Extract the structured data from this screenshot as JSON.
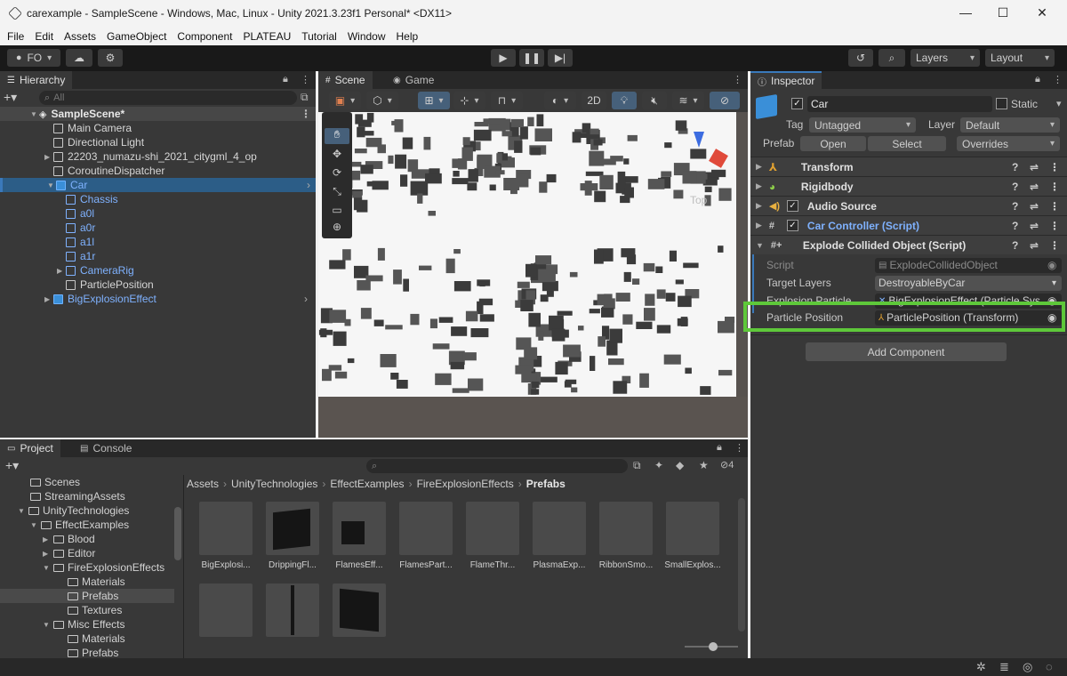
{
  "window": {
    "title": "carexample - SampleScene - Windows, Mac, Linux - Unity 2021.3.23f1 Personal* <DX11>",
    "minimize": "—",
    "maximize": "☐",
    "close": "✕"
  },
  "menu": [
    "File",
    "Edit",
    "Assets",
    "GameObject",
    "Component",
    "PLATEAU",
    "Tutorial",
    "Window",
    "Help"
  ],
  "toolbar": {
    "account": "FO",
    "layers": "Layers",
    "layout": "Layout"
  },
  "hierarchy": {
    "tab": "Hierarchy",
    "search_placeholder": "All",
    "scene": "SampleScene*",
    "items": [
      {
        "label": "Main Camera"
      },
      {
        "label": "Directional Light"
      },
      {
        "label": "22203_numazu-shi_2021_citygml_4_op"
      },
      {
        "label": "CoroutineDispatcher"
      },
      {
        "label": "Car"
      },
      {
        "label": "Chassis"
      },
      {
        "label": "a0l"
      },
      {
        "label": "a0r"
      },
      {
        "label": "a1l"
      },
      {
        "label": "a1r"
      },
      {
        "label": "CameraRig"
      },
      {
        "label": "ParticlePosition"
      },
      {
        "label": "BigExplosionEffect"
      }
    ]
  },
  "scene": {
    "tab_scene": "Scene",
    "tab_game": "Game",
    "btn_2d": "2D",
    "gizmo_label": "Top"
  },
  "inspector": {
    "tab": "Inspector",
    "object_name": "Car",
    "static_label": "Static",
    "tag_label": "Tag",
    "tag_value": "Untagged",
    "layer_label": "Layer",
    "layer_value": "Default",
    "prefab_label": "Prefab",
    "prefab_open": "Open",
    "prefab_select": "Select",
    "prefab_overrides": "Overrides",
    "components": [
      {
        "name": "Transform"
      },
      {
        "name": "Rigidbody"
      },
      {
        "name": "Audio Source"
      },
      {
        "name": "Car Controller (Script)"
      },
      {
        "name": "Explode Collided Object (Script)"
      }
    ],
    "props": {
      "script_label": "Script",
      "script_value": "ExplodeCollidedObject",
      "target_label": "Target Layers",
      "target_value": "DestroyableByCar",
      "particle_label": "Explosion Particle",
      "particle_value": "BigExplosionEffect (Particle Sys",
      "position_label": "Particle Position",
      "position_value": "ParticlePosition (Transform)"
    },
    "add_component": "Add Component",
    "highlight_color": "#5ec83a"
  },
  "project": {
    "tab_project": "Project",
    "tab_console": "Console",
    "hidden_count": "4",
    "tree": [
      {
        "label": "Scenes"
      },
      {
        "label": "StreamingAssets"
      },
      {
        "label": "UnityTechnologies"
      },
      {
        "label": "EffectExamples"
      },
      {
        "label": "Blood"
      },
      {
        "label": "Editor"
      },
      {
        "label": "FireExplosionEffects"
      },
      {
        "label": "Materials"
      },
      {
        "label": "Prefabs"
      },
      {
        "label": "Textures"
      },
      {
        "label": "Misc Effects"
      },
      {
        "label": "Materials"
      },
      {
        "label": "Prefabs"
      }
    ],
    "breadcrumb": [
      "Assets",
      "UnityTechnologies",
      "EffectExamples",
      "FireExplosionEffects",
      "Prefabs"
    ],
    "assets": [
      {
        "label": "BigExplosi..."
      },
      {
        "label": "DrippingFl..."
      },
      {
        "label": "FlamesEff..."
      },
      {
        "label": "FlamesPart..."
      },
      {
        "label": "FlameThr..."
      },
      {
        "label": "PlasmaExp..."
      },
      {
        "label": "RibbonSmo..."
      },
      {
        "label": "SmallExplos..."
      }
    ]
  },
  "colors": {
    "blue_text": "#7fb2ff",
    "accent": "#3a79bb"
  }
}
